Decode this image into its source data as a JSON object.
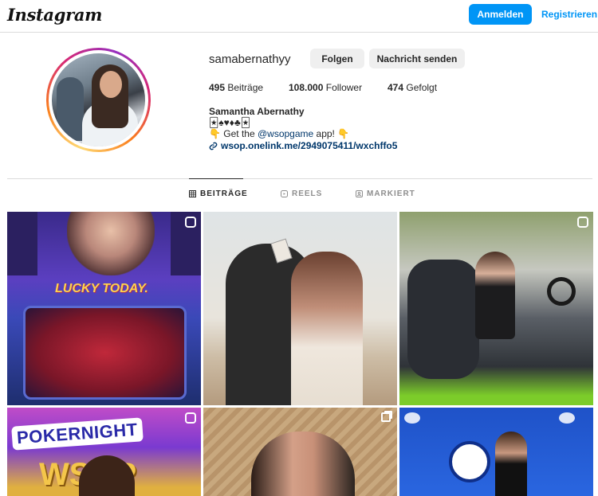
{
  "topbar": {
    "logo": "Instagram",
    "login_label": "Anmelden",
    "register_label": "Registrieren"
  },
  "profile": {
    "username": "samabernathyy",
    "follow_label": "Folgen",
    "message_label": "Nachricht senden",
    "stats": {
      "posts_value": "495",
      "posts_label": "Beiträge",
      "followers_value": "108.000",
      "followers_label": "Follower",
      "following_value": "474",
      "following_label": "Gefolgt"
    },
    "full_name": "Samantha Abernathy",
    "bio_line1": "🃏♠♥♦♣🃏",
    "bio_line2_pre": "👇 Get the ",
    "bio_mention": "@wsopgame",
    "bio_line2_post": " app! 👇",
    "link": "wsop.onelink.me/2949075411/wxchffo5"
  },
  "tabs": [
    {
      "label": "BEITRÄGE",
      "icon": "grid-icon",
      "active": true
    },
    {
      "label": "REELS",
      "icon": "reels-icon",
      "active": false
    },
    {
      "label": "MARKIERT",
      "icon": "tagged-icon",
      "active": false
    }
  ],
  "grid": {
    "tile1": {
      "type": "reel",
      "text": "LUCKY TODAY."
    },
    "tile2": {
      "type": "photo"
    },
    "tile3": {
      "type": "reel"
    },
    "tile4": {
      "type": "reel",
      "text": "POKERNIGHT",
      "text2": "WSOP"
    },
    "tile5": {
      "type": "carousel"
    },
    "tile6": {
      "type": "photo"
    }
  },
  "colors": {
    "accent": "#0095f6",
    "text": "#262626",
    "muted": "#8e8e8e",
    "link": "#00376b"
  }
}
